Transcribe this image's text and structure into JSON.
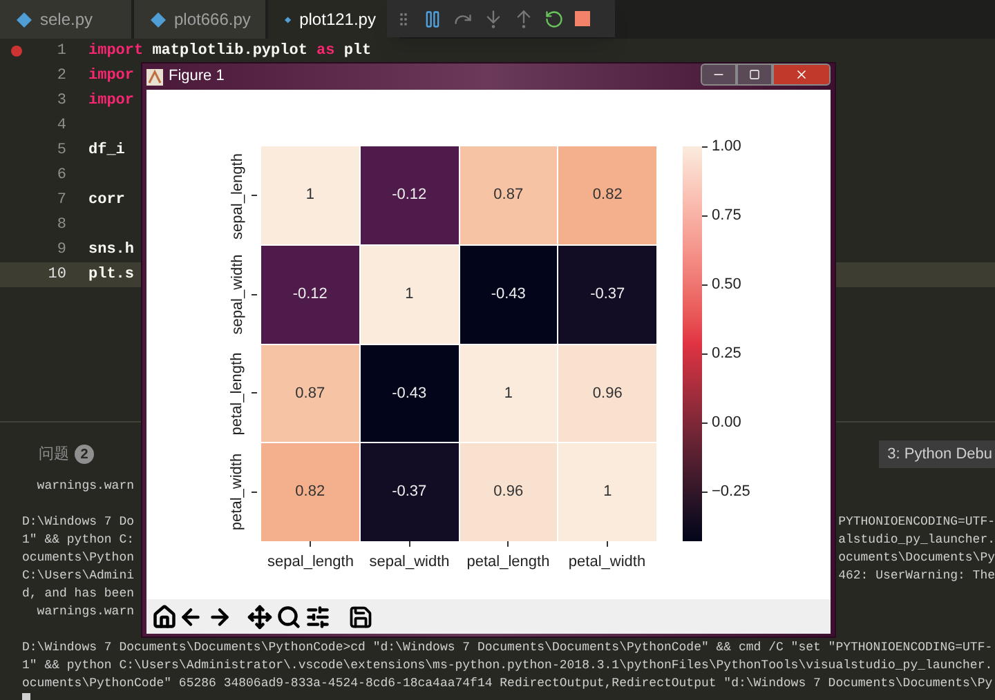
{
  "tabs": [
    {
      "label": "sele.py",
      "selected": false
    },
    {
      "label": "plot666.py",
      "selected": false
    },
    {
      "label": "plot121.py",
      "selected": true
    }
  ],
  "editor": {
    "lines": [
      {
        "number": "1",
        "breakpoint": true,
        "current": false,
        "tokens": [
          {
            "text": "import",
            "kind": "keyword"
          },
          {
            "text": " matplotlib.pyplot ",
            "kind": "plain"
          },
          {
            "text": "as",
            "kind": "keyword"
          },
          {
            "text": " plt",
            "kind": "plain"
          }
        ]
      },
      {
        "number": "2",
        "breakpoint": false,
        "current": false,
        "tokens": [
          {
            "text": "impor",
            "kind": "keyword"
          }
        ]
      },
      {
        "number": "3",
        "breakpoint": false,
        "current": false,
        "tokens": [
          {
            "text": "impor",
            "kind": "keyword"
          }
        ]
      },
      {
        "number": "4",
        "breakpoint": false,
        "current": false
      },
      {
        "number": "5",
        "breakpoint": false,
        "current": false,
        "tokens": [
          {
            "text": "df_i",
            "kind": "plain"
          }
        ]
      },
      {
        "number": "6",
        "breakpoint": false,
        "current": false
      },
      {
        "number": "7",
        "breakpoint": false,
        "current": false,
        "tokens": [
          {
            "text": "corr",
            "kind": "plain"
          }
        ]
      },
      {
        "number": "8",
        "breakpoint": false,
        "current": false
      },
      {
        "number": "9",
        "breakpoint": false,
        "current": false,
        "tokens": [
          {
            "text": "sns.h",
            "kind": "plain"
          }
        ]
      },
      {
        "number": "10",
        "breakpoint": false,
        "current": true,
        "tokens": [
          {
            "text": "plt.s",
            "kind": "plain"
          }
        ]
      }
    ]
  },
  "panel": {
    "tabs": [
      {
        "label": "问题",
        "badge": "2"
      }
    ],
    "terminal_selector": "3: Python Debu",
    "terminal": [
      [
        {
          "left": "  warnings.warn"
        }
      ],
      [
        {
          "left": "D:\\Windows 7 Do",
          "right": "PYTHONIOENCODING=UTF-"
        },
        {
          "left": "1\" && python C:",
          "right": "alstudio_py_launcher."
        },
        {
          "left": "ocuments\\Python",
          "right": "ocuments\\Documents\\Py"
        },
        {
          "left": "C:\\Users\\Admini",
          "right": "462: UserWarning: The"
        },
        {
          "left": "d, and has been"
        },
        {
          "left": "  warnings.warn"
        }
      ],
      [
        {
          "left": "D:\\Windows 7 Documents\\Documents\\PythonCode>cd \"d:\\Windows 7 Documents\\Documents\\PythonCode\" && cmd /C \"set \"PYTHONIOENCODING=UTF-"
        },
        {
          "left": "1\" && python C:\\Users\\Administrator\\.vscode\\extensions\\ms-python.python-2018.3.1\\pythonFiles\\PythonTools\\visualstudio_py_launcher."
        },
        {
          "left": "ocuments\\PythonCode\" 65286 34806ad9-833a-4524-8cd6-18ca4aa74f14 RedirectOutput,RedirectOutput \"d:\\Windows 7 Documents\\Documents\\Py"
        }
      ]
    ]
  },
  "figure": {
    "title": "Figure 1",
    "heatmap": {
      "rows": [
        {
          "label": "sepal_length",
          "cells": [
            {
              "text": "1",
              "color": "#faebdd"
            },
            {
              "text": "-0.12",
              "color": "#4f1b4b"
            },
            {
              "text": "0.87",
              "color": "#f6c4a5"
            },
            {
              "text": "0.82",
              "color": "#f4b08c"
            }
          ]
        },
        {
          "label": "sepal_width",
          "cells": [
            {
              "text": "-0.12",
              "color": "#4f1b4b"
            },
            {
              "text": "1",
              "color": "#faebdd"
            },
            {
              "text": "-0.43",
              "color": "#03051a"
            },
            {
              "text": "-0.37",
              "color": "#130c25"
            }
          ]
        },
        {
          "label": "petal_length",
          "cells": [
            {
              "text": "0.87",
              "color": "#f6c4a5"
            },
            {
              "text": "-0.43",
              "color": "#03051a"
            },
            {
              "text": "1",
              "color": "#faebdd"
            },
            {
              "text": "0.96",
              "color": "#f8e1cf"
            }
          ]
        },
        {
          "label": "petal_width",
          "cells": [
            {
              "text": "0.82",
              "color": "#f4b08c"
            },
            {
              "text": "-0.37",
              "color": "#130c25"
            },
            {
              "text": "0.96",
              "color": "#f8e1cf"
            },
            {
              "text": "1",
              "color": "#faebdd"
            }
          ]
        }
      ],
      "x_axis_labels": [
        "sepal_length",
        "sepal_width",
        "petal_length",
        "petal_width"
      ],
      "colorbar_ticks": [
        "1.00",
        "0.75",
        "0.50",
        "0.25",
        "0.00",
        "−0.25"
      ]
    }
  }
}
